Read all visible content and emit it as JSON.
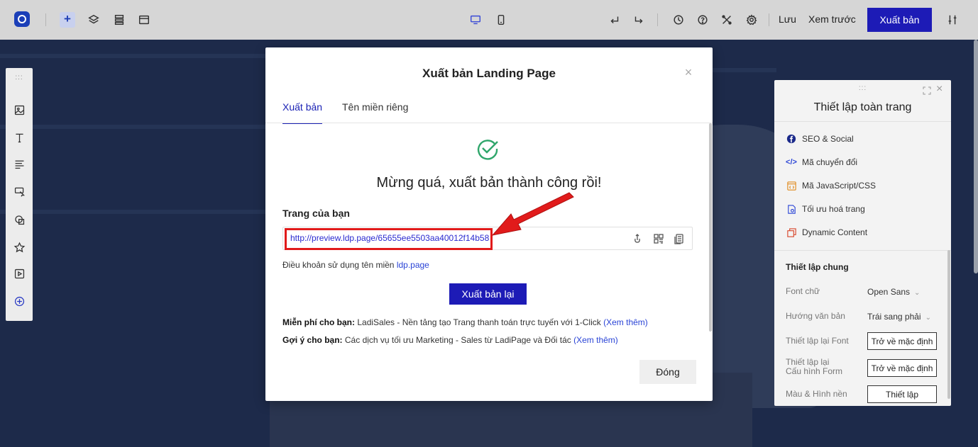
{
  "toolbar": {
    "save_label": "Lưu",
    "preview_label": "Xem trước",
    "publish_label": "Xuất bản"
  },
  "modal": {
    "title": "Xuất bản Landing Page",
    "tabs": [
      {
        "label": "Xuất bản",
        "active": true
      },
      {
        "label": "Tên miền riêng",
        "active": false
      }
    ],
    "success_message": "Mừng quá, xuất bản thành công rồi!",
    "your_page_label": "Trang của bạn",
    "page_url": "http://preview.ldp.page/65655ee5503aa40012f14b58",
    "terms_prefix": "Điều khoản sử dụng tên miền",
    "terms_link": "ldp.page",
    "republish_label": "Xuất bản lại",
    "promo_free": {
      "bold": "Miễn phí cho bạn:",
      "text": "LadiSales - Nền tảng tạo Trang thanh toán trực tuyến với 1-Click",
      "link": "(Xem thêm)"
    },
    "promo_suggest": {
      "bold": "Gợi ý cho bạn:",
      "text": "Các dịch vụ tối ưu Marketing - Sales từ LadiPage và Đối tác",
      "link": "(Xem thêm)"
    },
    "close_label": "Đóng"
  },
  "settings_panel": {
    "title": "Thiết lập toàn trang",
    "items": [
      {
        "label": "SEO & Social",
        "icon": "facebook-icon"
      },
      {
        "label": "Mã chuyển đổi",
        "icon": "code-icon"
      },
      {
        "label": "Mã JavaScript/CSS",
        "icon": "js-file-icon"
      },
      {
        "label": "Tối ưu hoá trang",
        "icon": "optimize-doc-icon"
      },
      {
        "label": "Dynamic Content",
        "icon": "dynamic-content-icon"
      }
    ],
    "section_title": "Thiết lập chung",
    "font_label": "Font chữ",
    "font_value": "Open Sans",
    "direction_label": "Hướng văn bản",
    "direction_value": "Trái sang phải",
    "reset_font_label": "Thiết lập lại Font",
    "reset_form_label_1": "Thiết lập lại",
    "reset_form_label_2": "Cấu hình Form",
    "reset_default_label": "Trở về mặc định",
    "bg_label": "Màu & Hình nền",
    "bg_button": "Thiết lập"
  },
  "colors": {
    "primary": "#1d1bb6",
    "success": "#2fa66b",
    "highlight": "#e11b1b"
  }
}
